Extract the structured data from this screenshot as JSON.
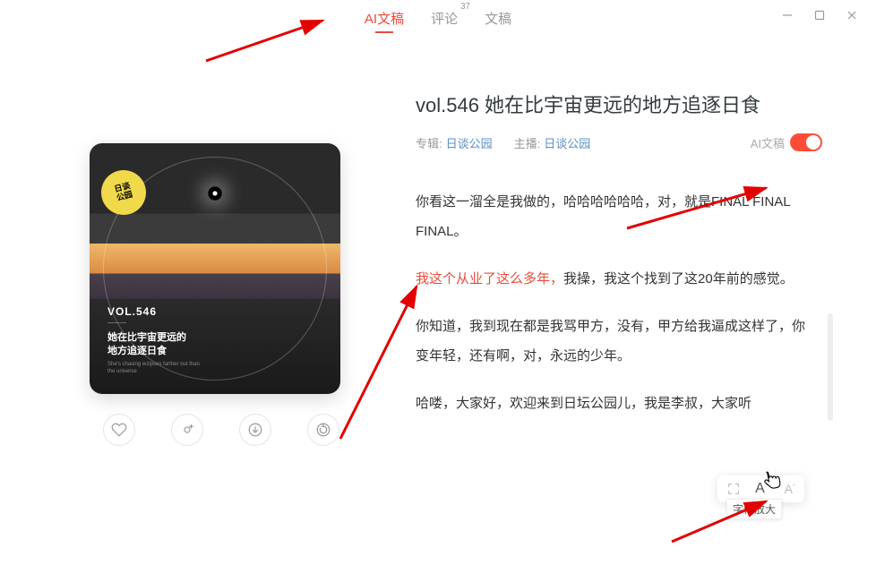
{
  "tabs": {
    "ai": "AI文稿",
    "comments": "评论",
    "comments_count": "37",
    "transcript": "文稿"
  },
  "episode": {
    "title": "vol.546 她在比宇宙更远的地方追逐日食",
    "album_label": "专辑:",
    "album_name": "日谈公园",
    "host_label": "主播:",
    "host_name": "日谈公园",
    "ai_toggle_label": "AI文稿"
  },
  "cover": {
    "sticker_line1": "日谈",
    "sticker_line2": "公园",
    "vol": "VOL.546",
    "title_line1": "她在比宇宙更远的",
    "title_line2": "地方追逐日食"
  },
  "transcript": {
    "p1": "你看这一溜全是我做的，哈哈哈哈哈哈，对，就是FINAL FINAL FINAL。",
    "p2_hl": "我这个从业了这么多年，",
    "p2_rest": "我操，我这个找到了这20年前的感觉。",
    "p3": "你知道，我到现在都是我骂甲方，没有，甲方给我逼成这样了，你变年轻，还有啊，对，永远的少年。",
    "p4": "哈喽，大家好，欢迎来到日坛公园儿，我是李叔，大家听"
  },
  "font_controls": {
    "tooltip": "字体放大"
  }
}
